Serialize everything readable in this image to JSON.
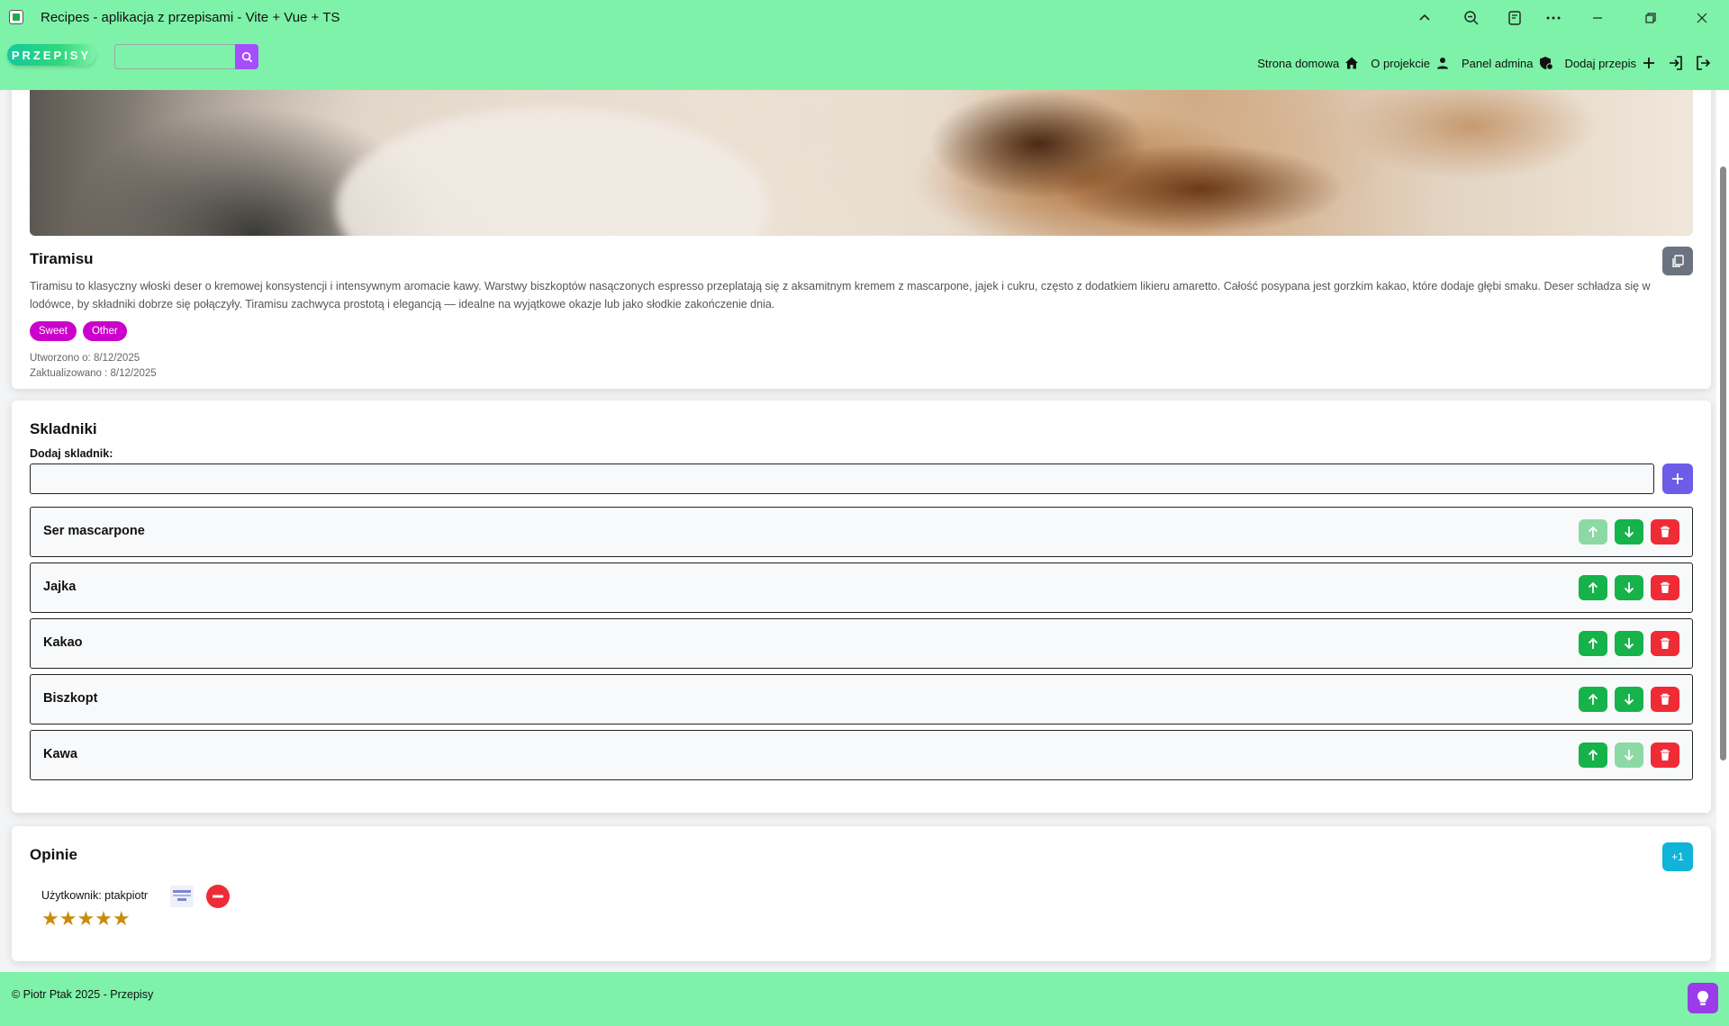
{
  "window": {
    "title": "Recipes - aplikacja z przepisami - Vite + Vue + TS"
  },
  "navbar": {
    "brand": "PRZEPISY",
    "search": {
      "placeholder": "",
      "value": ""
    },
    "links": [
      {
        "label": "Strona domowa",
        "icon": "home-icon"
      },
      {
        "label": "O projekcie",
        "icon": "user-icon"
      },
      {
        "label": "Panel admina",
        "icon": "admin-shield-icon"
      },
      {
        "label": "Dodaj przepis",
        "icon": "plus-icon"
      }
    ]
  },
  "recipe": {
    "title": "Tiramisu",
    "description": "Tiramisu to klasyczny włoski deser o kremowej konsystencji i intensywnym aromacie kawy. Warstwy biszkoptów nasączonych espresso przeplatają się z aksamitnym kremem z mascarpone, jajek i cukru, często z dodatkiem likieru amaretto. Całość posypana jest gorzkim kakao, które dodaje głębi smaku. Deser schładza się w lodówce, by składniki dobrze się połączyły. Tiramisu zachwyca prostotą i elegancją — idealne na wyjątkowe okazje lub jako słodkie zakończenie dnia.",
    "tags": [
      "Sweet",
      "Other"
    ],
    "created": "Utworzono o: 8/12/2025",
    "updated": "Zaktualizowano : 8/12/2025"
  },
  "ingredients": {
    "title": "Skladniki",
    "add_label": "Dodaj skladnik:",
    "input_value": "",
    "items": [
      {
        "name": "Ser mascarpone",
        "up_enabled": false,
        "down_enabled": true
      },
      {
        "name": "Jajka",
        "up_enabled": true,
        "down_enabled": true
      },
      {
        "name": "Kakao",
        "up_enabled": true,
        "down_enabled": true
      },
      {
        "name": "Biszkopt",
        "up_enabled": true,
        "down_enabled": true
      },
      {
        "name": "Kawa",
        "up_enabled": true,
        "down_enabled": false
      }
    ]
  },
  "reviews": {
    "title": "Opinie",
    "add_label": "+1",
    "items": [
      {
        "user": "Użytkownik: ptakpiotr",
        "rating": 5,
        "stars": "★★★★★"
      }
    ]
  },
  "footer": {
    "text": "© Piotr Ptak 2025 - Przepisy"
  },
  "colors": {
    "nav_bg": "#7ef2a8",
    "accent_purple": "#a64dff",
    "tag": "#cc00cc",
    "arrow_green": "#16b24a",
    "delete_red": "#ef2b36",
    "add_indigo": "#6c5ce7",
    "plus1_cyan": "#0fb4d8",
    "star": "#c98b0a"
  }
}
